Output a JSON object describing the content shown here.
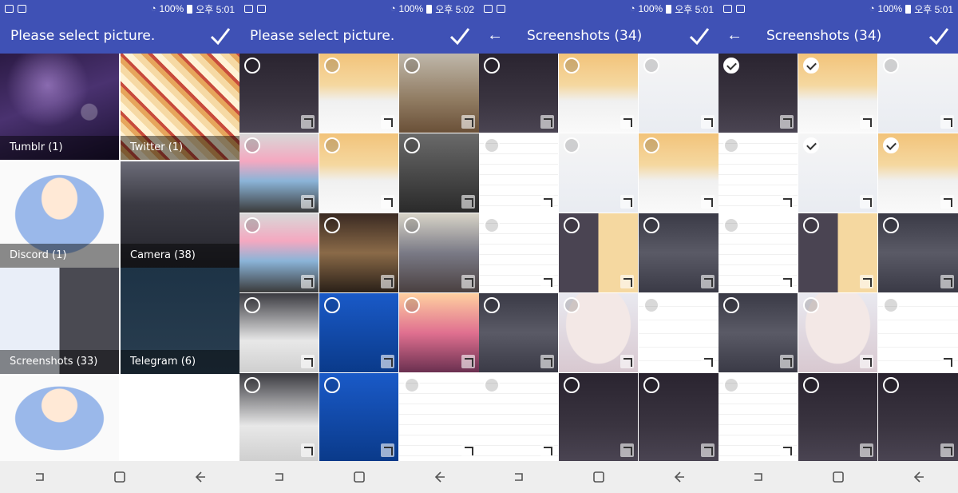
{
  "status": {
    "screens": [
      {
        "battery": "100%",
        "time": "오후 5:01"
      },
      {
        "battery": "100%",
        "time": "오후 5:02"
      },
      {
        "battery": "100%",
        "time": "오후 5:01"
      },
      {
        "battery": "100%",
        "time": "오후 5:01"
      }
    ]
  },
  "screen1": {
    "title": "Please select picture.",
    "albums": [
      {
        "label": "Tumblr (1)"
      },
      {
        "label": "Twitter (1)"
      },
      {
        "label": "Discord (1)"
      },
      {
        "label": "Camera (38)"
      },
      {
        "label": "Screenshots (33)"
      },
      {
        "label": "Telegram (6)"
      },
      {
        "label": ""
      }
    ]
  },
  "screen2": {
    "title": "Please select picture."
  },
  "screen3": {
    "title": "Screenshots (34)"
  },
  "screen4": {
    "title": "Screenshots (34)",
    "selected_indices": [
      0,
      1,
      4,
      5
    ]
  },
  "icons": {
    "confirm": "check-icon",
    "back": "arrow-back-icon",
    "expand": "expand-icon",
    "nav_recent": "recent-apps-icon",
    "nav_home": "home-icon",
    "nav_back": "nav-back-icon"
  },
  "colors": {
    "appbar": "#3f51b5",
    "navbar": "#eeeeee"
  }
}
